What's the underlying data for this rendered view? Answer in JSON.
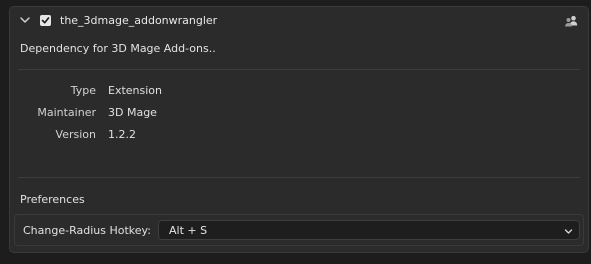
{
  "addon": {
    "name": "the_3dmage_addonwrangler",
    "enabled": true,
    "description": "Dependency for 3D Mage Add-ons.."
  },
  "info": [
    {
      "label": "Type",
      "value": "Extension"
    },
    {
      "label": "Maintainer",
      "value": "3D Mage"
    },
    {
      "label": "Version",
      "value": "1.2.2"
    }
  ],
  "preferences": {
    "title": "Preferences",
    "hotkey_label": "Change-Radius Hotkey:",
    "hotkey_value": "Alt + S"
  },
  "icons": {
    "expand": "chevron-down-icon",
    "checkbox": "checkbox-checked-icon",
    "users": "users-icon",
    "dropdown": "chevron-down-icon"
  },
  "colors": {
    "background": "#1d1d1d",
    "panel": "#2b2b2b",
    "field": "#1e1e1e",
    "text": "#e5e5e5"
  }
}
